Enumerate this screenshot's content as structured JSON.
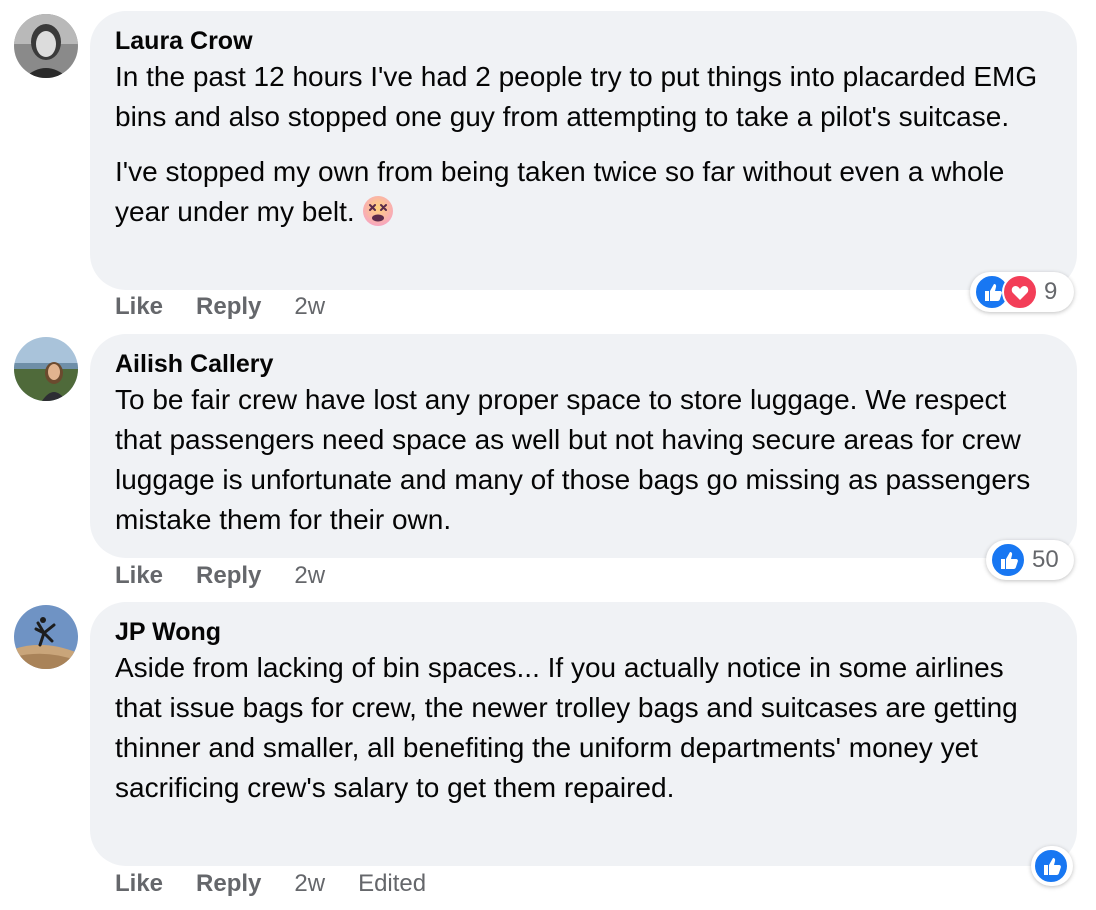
{
  "comments": [
    {
      "author": "Laura Crow",
      "paragraphs": [
        "In the past 12 hours I've had 2 people try to put things into placarded EMG bins and also stopped one guy from attempting to take a pilot's suitcase.",
        "I've stopped my own from being taken twice so far without even a whole year under my belt."
      ],
      "emoji_icon": "dizzy-face-emoji-icon",
      "actions": {
        "like": "Like",
        "reply": "Reply",
        "time": "2w"
      },
      "reactions": {
        "icons": [
          "like-icon",
          "love-icon"
        ],
        "count": "9"
      }
    },
    {
      "author": "Ailish Callery",
      "paragraphs": [
        "To be fair crew have lost any proper space to store luggage. We respect that passengers need space as well but not having secure areas for crew luggage is unfortunate and many of those bags go missing as passengers mistake them for their own."
      ],
      "actions": {
        "like": "Like",
        "reply": "Reply",
        "time": "2w"
      },
      "reactions": {
        "icons": [
          "like-icon"
        ],
        "count": "50"
      }
    },
    {
      "author": "JP Wong",
      "paragraphs": [
        "Aside from lacking of bin spaces... If you actually notice in some airlines that issue bags for crew, the newer trolley bags and suitcases are getting thinner and smaller, all benefiting the uniform departments' money yet sacrificing crew's salary to get them repaired."
      ],
      "actions": {
        "like": "Like",
        "reply": "Reply",
        "time": "2w",
        "edited": "Edited"
      },
      "reactions": {
        "icons": [
          "like-icon"
        ],
        "count": ""
      }
    }
  ],
  "colors": {
    "bubble": "#f0f2f5",
    "meta_text": "#65676b",
    "like_blue": "#1877f2",
    "love_red": "#f33e58"
  }
}
